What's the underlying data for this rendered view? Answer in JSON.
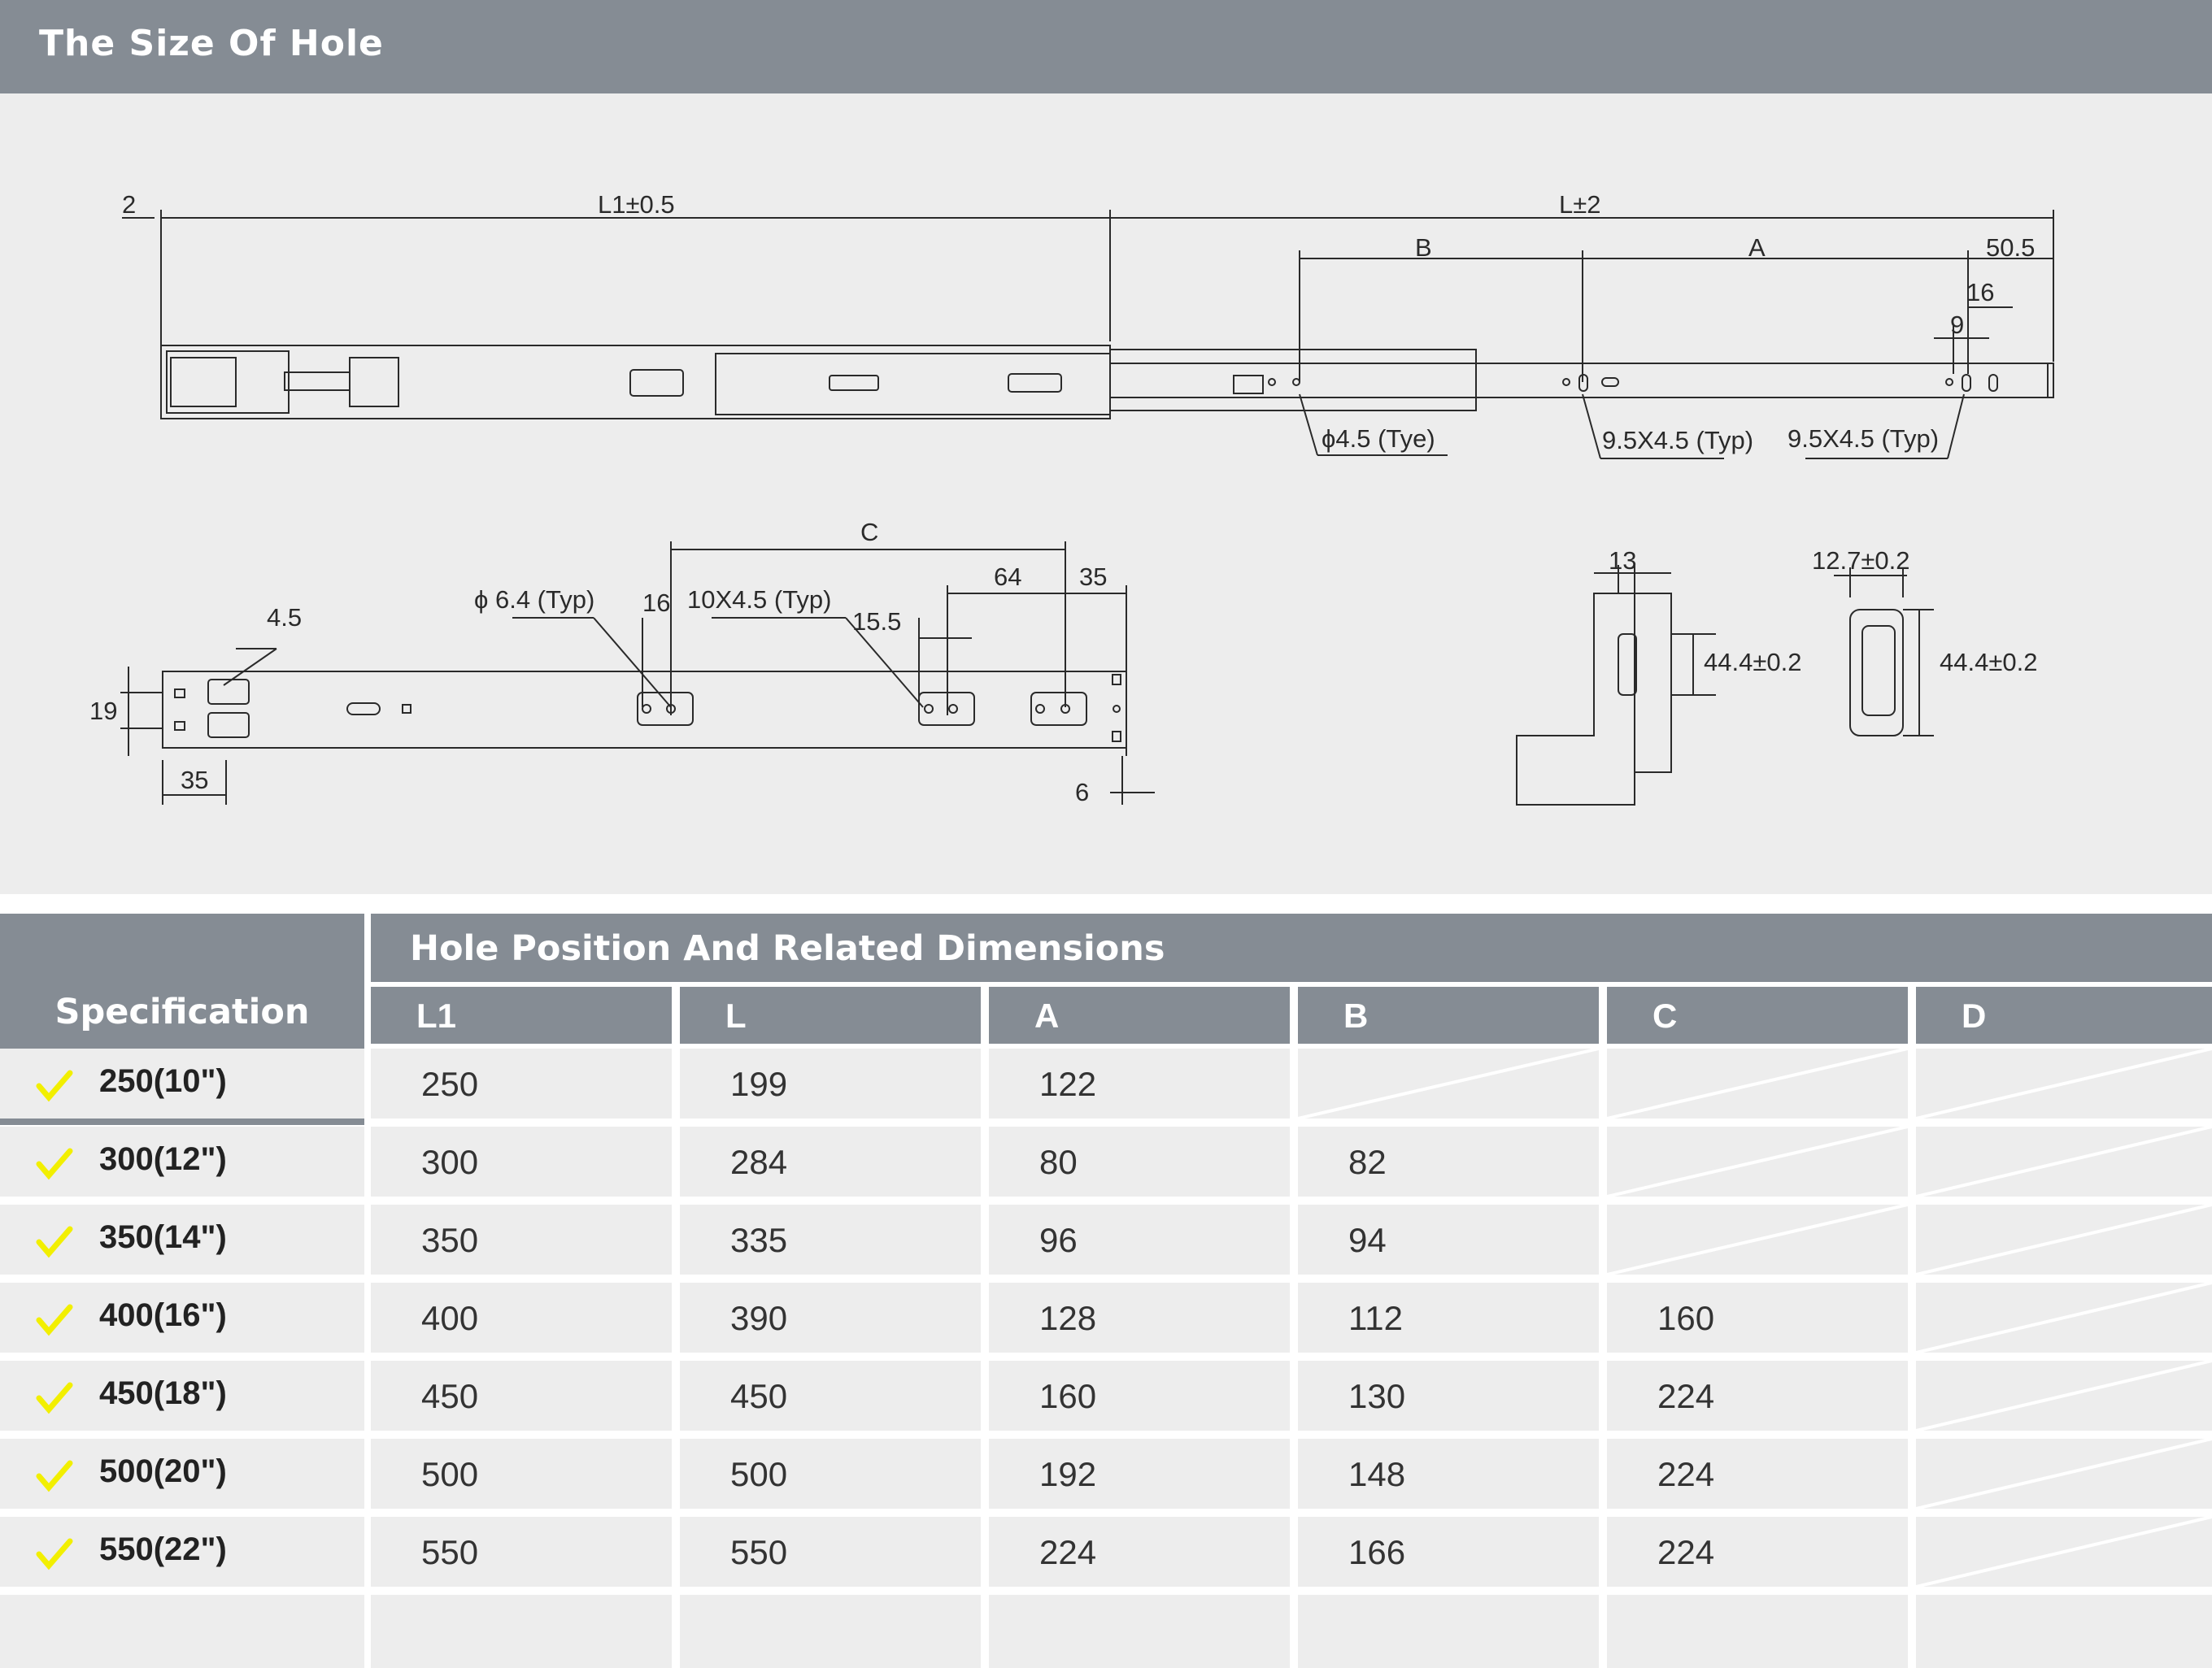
{
  "header": {
    "title": "The Size Of Hole"
  },
  "drawing": {
    "labels": {
      "dim_2": "2",
      "dim_l1": "L1±0.5",
      "dim_l": "L±2",
      "dim_b": "B",
      "dim_a": "A",
      "dim_50_5": "50.5",
      "dim_16_top": "16",
      "dim_9": "9",
      "hole_4_5": "ϕ4.5 (Tye)",
      "slot_1": "9.5X4.5 (Typ)",
      "slot_2": "9.5X4.5 (Typ)",
      "dim_c": "C",
      "dim_64": "64",
      "dim_35_top": "35",
      "dim_4_5": "4.5",
      "hole_6_4": "ϕ 6.4 (Typ)",
      "dim_16_bottom": "16",
      "slot_10x4_5": "10X4.5 (Typ)",
      "dim_15_5": "15.5",
      "dim_19": "19",
      "dim_35_bottom": "35",
      "dim_6": "6",
      "dim_13": "13",
      "dim_44_4_a": "44.4±0.2",
      "dim_12_7": "12.7±0.2",
      "dim_44_4_b": "44.4±0.2"
    }
  },
  "table": {
    "spec_header": "Specification",
    "group_header": "Hole Position And Related Dimensions",
    "columns": [
      "L1",
      "L",
      "A",
      "B",
      "C",
      "D"
    ],
    "accent_color": "#f2ef00",
    "rows": [
      {
        "spec": "250(10\")",
        "cells": [
          "250",
          "199",
          "122",
          "",
          "",
          ""
        ]
      },
      {
        "spec": "300(12\")",
        "cells": [
          "300",
          "284",
          "80",
          "82",
          "",
          ""
        ]
      },
      {
        "spec": "350(14\")",
        "cells": [
          "350",
          "335",
          "96",
          "94",
          "",
          ""
        ]
      },
      {
        "spec": "400(16\")",
        "cells": [
          "400",
          "390",
          "128",
          "112",
          "160",
          ""
        ]
      },
      {
        "spec": "450(18\")",
        "cells": [
          "450",
          "450",
          "160",
          "130",
          "224",
          ""
        ]
      },
      {
        "spec": "500(20\")",
        "cells": [
          "500",
          "500",
          "192",
          "148",
          "224",
          ""
        ]
      },
      {
        "spec": "550(22\")",
        "cells": [
          "550",
          "550",
          "224",
          "166",
          "224",
          ""
        ]
      }
    ]
  }
}
